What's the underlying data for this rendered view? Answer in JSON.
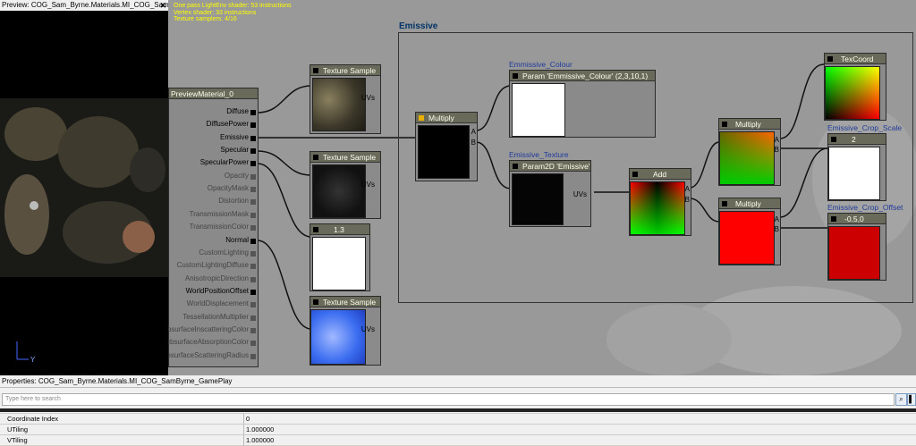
{
  "preview": {
    "title": "Preview: COG_Sam_Byrne.Materials.MI_COG_SamByrn...",
    "axis_y": "Y"
  },
  "stats": [
    "One pass LightEnv shader: 53 instructions",
    "Vertex shader: 33 instructions",
    "Texture samplers: 4/16"
  ],
  "comment_title": "Emissive",
  "preview_material": {
    "title": "PreviewMaterial_0",
    "inputs": [
      "Diffuse",
      "DiffusePower",
      "Emissive",
      "Specular",
      "SpecularPower",
      "Opacity",
      "OpacityMask",
      "Distortion",
      "TransmissionMask",
      "TransmissionColor",
      "Normal",
      "CustomLighting",
      "CustomLightingDiffuse",
      "AnisotropicDirection",
      "WorldPositionOffset",
      "WorldDisplacement",
      "TessellationMultiplier",
      "SubsurfaceInscatteringColor",
      "SubsurfaceAbsorptionColor",
      "SubsurfaceScatteringRadius"
    ]
  },
  "nodes": {
    "tex1": "Texture Sample",
    "tex2": "Texture Sample",
    "tex3": "Texture Sample",
    "const13": "1.3",
    "multiply_main": "Multiply",
    "param_colour": "Param 'Emmissive_Colour' (2,3,10,1)",
    "param_texture": "Param2D 'Emissive'",
    "add": "Add",
    "multiply_top": "Multiply",
    "multiply_bottom": "Multiply",
    "texcoord": "TexCoord",
    "crop_scale_val": "2",
    "crop_offset_val": "-0.5,0"
  },
  "labels": {
    "param_colour": "Emmissive_Colour",
    "param_texture": "Emissive_Texture",
    "crop_scale": "Emissive_Crop_Scale",
    "crop_offset": "Emissive_Crop_Offset",
    "uvs": "UVs",
    "a": "A",
    "b": "B"
  },
  "props": {
    "title": "Properties: COG_Sam_Byrne.Materials.MI_COG_SamByrne_GamePlay",
    "search_placeholder": "Type here to search",
    "rows": [
      {
        "key": "Coordinate Index",
        "value": "0"
      },
      {
        "key": "UTiling",
        "value": "1.000000"
      },
      {
        "key": "VTiling",
        "value": "1.000000"
      }
    ]
  }
}
